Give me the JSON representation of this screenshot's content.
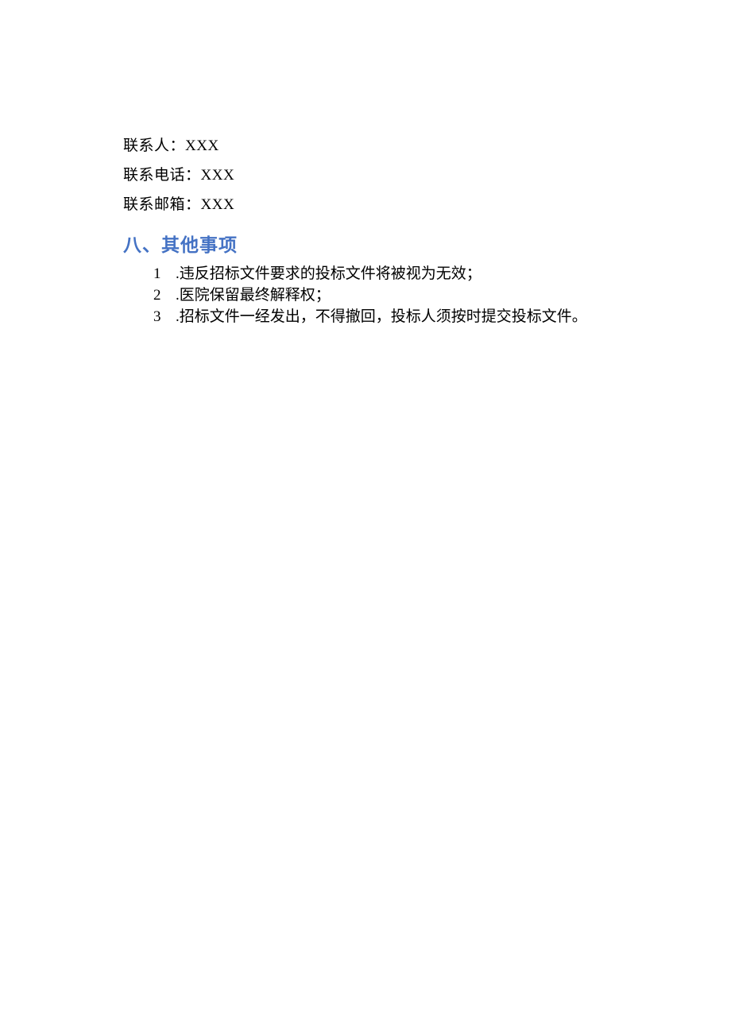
{
  "contact": {
    "person_label": "联系人：",
    "person_value": "XXX",
    "phone_label": "联系电话：",
    "phone_value": "XXX",
    "email_label": "联系邮箱：",
    "email_value": "XXX"
  },
  "section": {
    "heading": "八、其他事项",
    "items": [
      {
        "num": "1",
        "text": ".违反招标文件要求的投标文件将被视为无效；"
      },
      {
        "num": "2",
        "text": ".医院保留最终解释权；"
      },
      {
        "num": "3",
        "text": ".招标文件一经发出，不得撤回，投标人须按时提交投标文件。"
      }
    ]
  }
}
